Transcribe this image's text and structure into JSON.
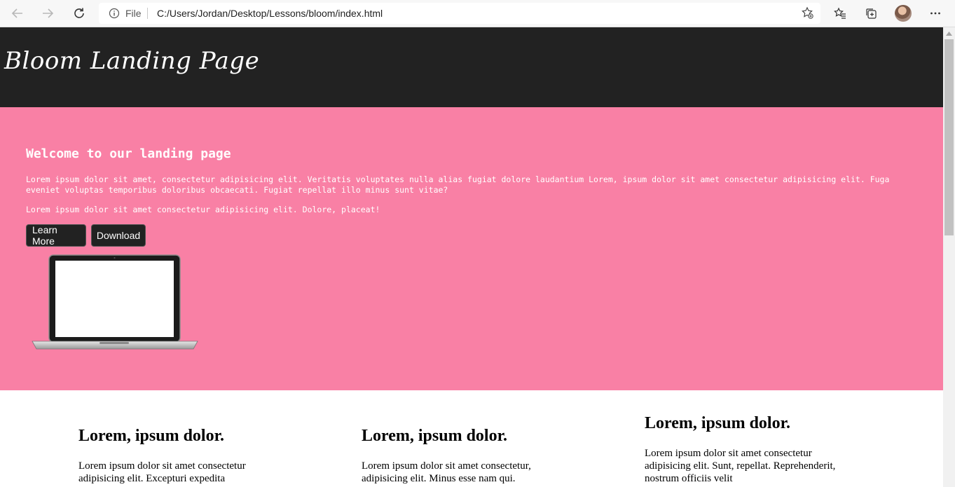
{
  "browser": {
    "scheme_label": "File",
    "url": "C:/Users/Jordan/Desktop/Lessons/bloom/index.html"
  },
  "header": {
    "logo_text": "Bloom Landing Page"
  },
  "hero": {
    "title": "Welcome to our landing page",
    "paragraph1": "Lorem ipsum dolor sit amet, consectetur adipisicing elit. Veritatis voluptates nulla alias fugiat dolore laudantium Lorem, ipsum dolor sit amet consectetur adipisicing elit. Fuga eveniet voluptas temporibus doloribus obcaecati. Fugiat repellat illo minus sunt vitae?",
    "paragraph2": "Lorem ipsum dolor sit amet consectetur adipisicing elit. Dolore, placeat!",
    "learn_more_label": "Learn More",
    "download_label": "Download"
  },
  "features": [
    {
      "title": "Lorem, ipsum dolor.",
      "text": "Lorem ipsum dolor sit amet consectetur adipisicing elit. Excepturi expedita"
    },
    {
      "title": "Lorem, ipsum dolor.",
      "text": "Lorem ipsum dolor sit amet consectetur, adipisicing elit. Minus esse nam qui."
    },
    {
      "title": "Lorem, ipsum dolor.",
      "text": "Lorem ipsum dolor sit amet consectetur adipisicing elit. Sunt, repellat. Reprehenderit, nostrum officiis velit"
    }
  ],
  "colors": {
    "header_bg": "#222222",
    "hero_bg": "#f980a5",
    "button_bg": "#222222"
  },
  "icons": [
    "back-arrow-icon",
    "forward-arrow-icon",
    "reload-icon",
    "info-icon",
    "add-favorite-icon",
    "favorites-icon",
    "collections-icon",
    "more-icon",
    "laptop-image"
  ]
}
